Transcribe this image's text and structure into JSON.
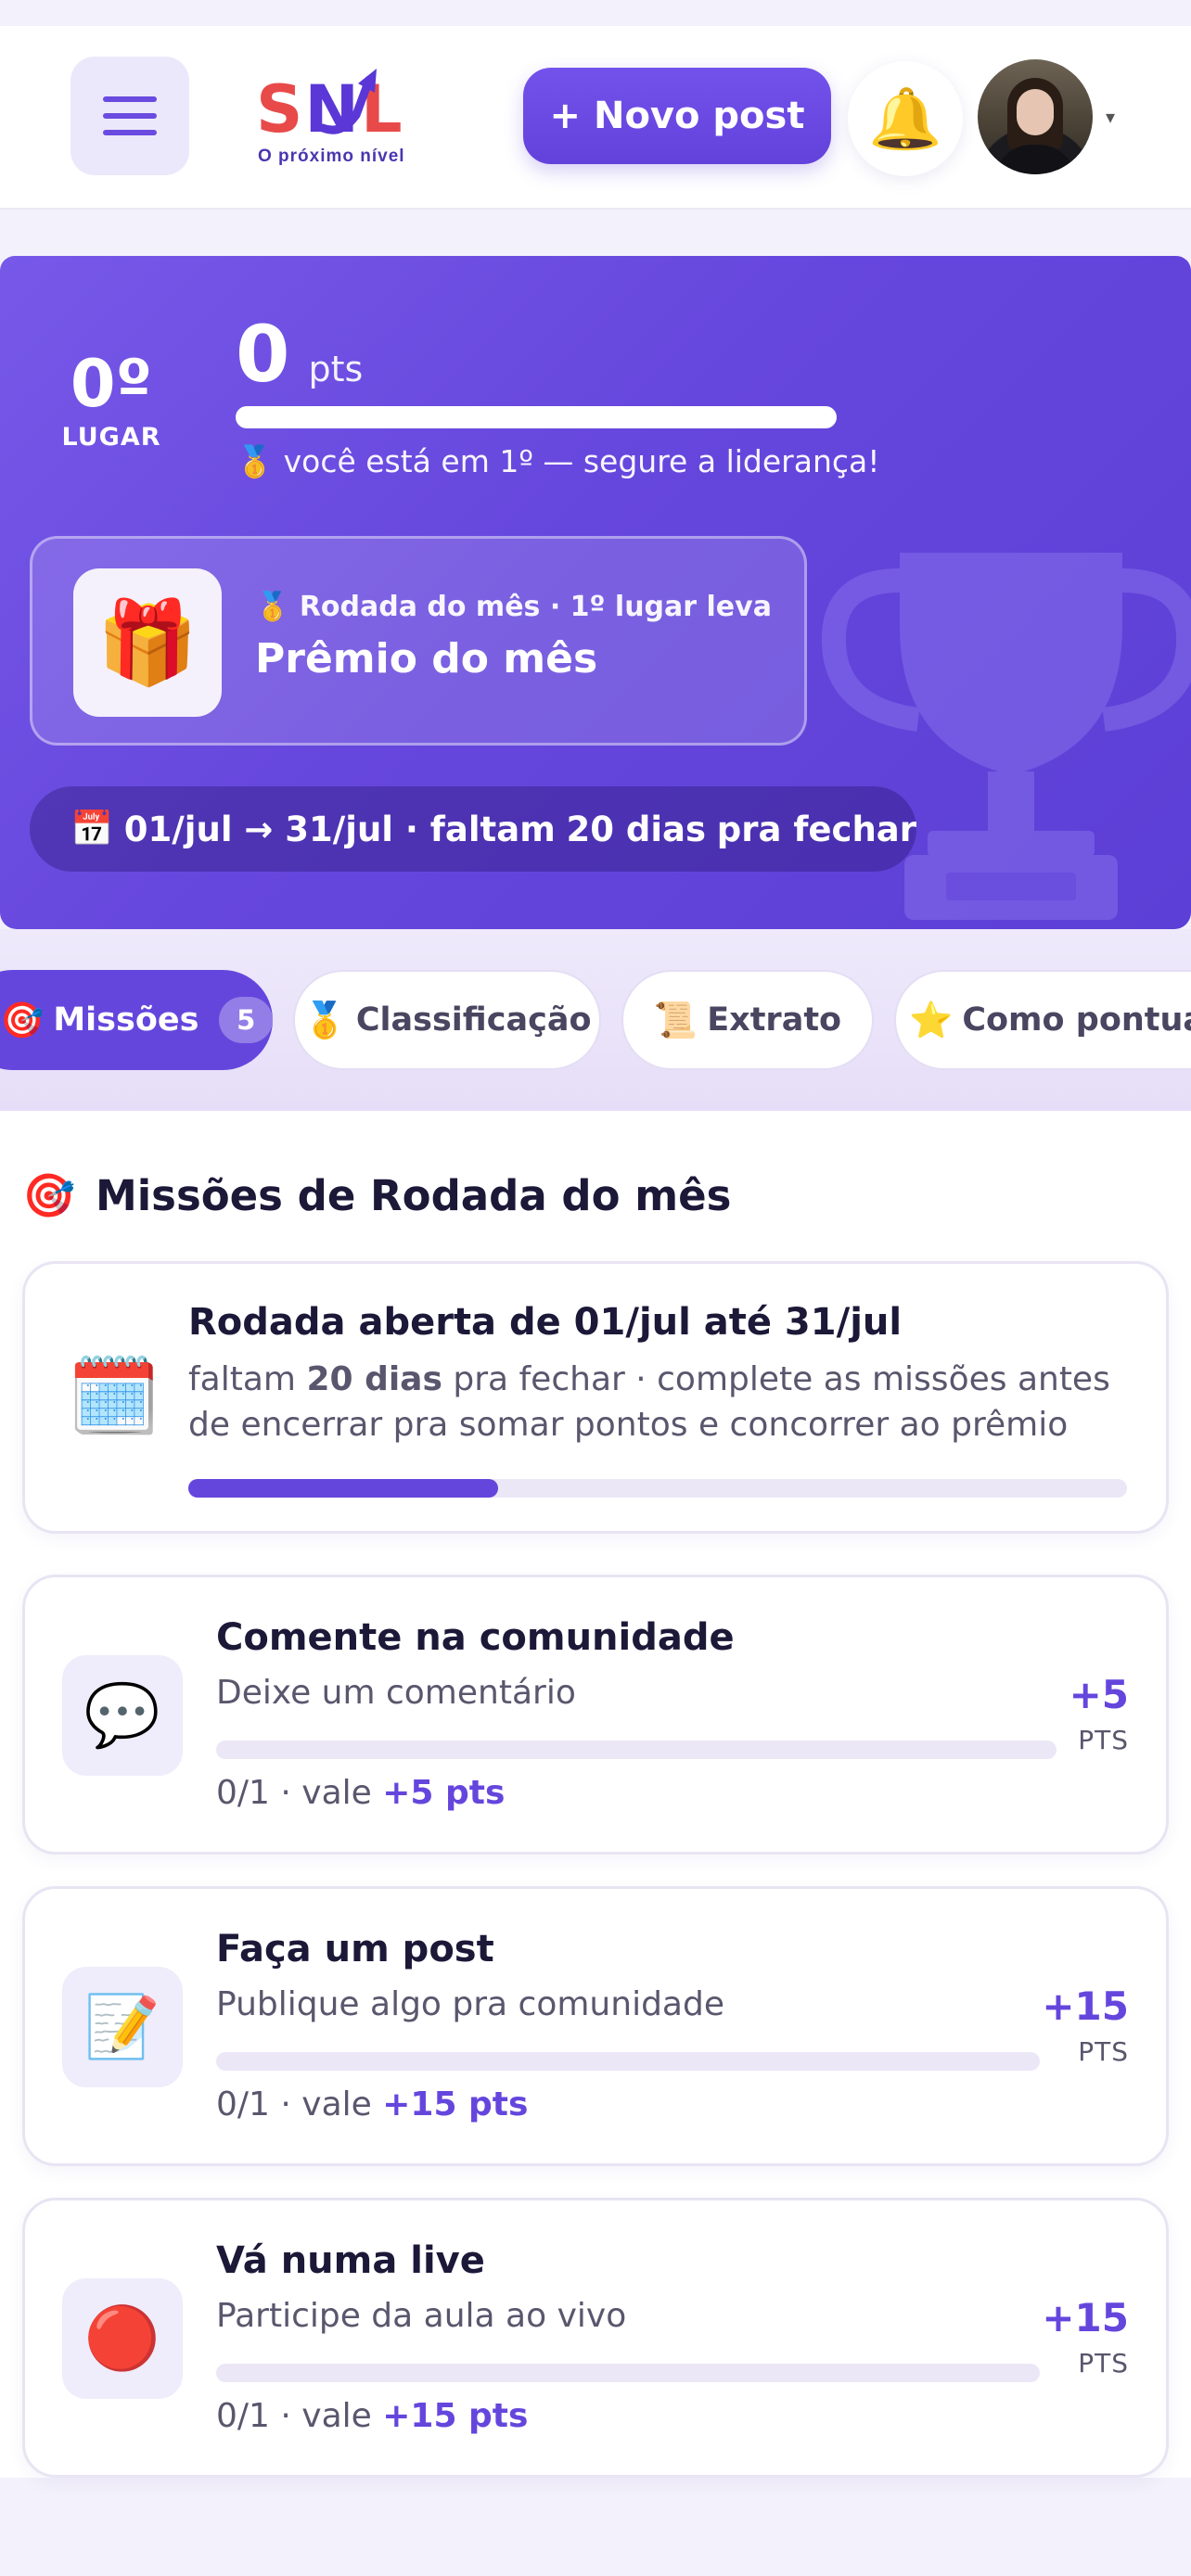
{
  "header": {
    "logo_text": "SNL",
    "logo_tagline": "O próximo nível",
    "new_post_label": "+ Novo post",
    "avatar_caret": "▾"
  },
  "hero": {
    "rank": "0º",
    "rank_label": "LUGAR",
    "points": "0",
    "points_unit": "pts",
    "points_progress": 1.0,
    "rank_message_icon": "🥇",
    "rank_message": "você está em 1º — segure a liderança!",
    "prize": {
      "icon": "🎁",
      "subtitle_icon": "🥇",
      "subtitle": "Rodada do mês · 1º lugar leva",
      "title": "Prêmio do mês"
    },
    "date_pill": {
      "icon": "📅",
      "range": "01/jul → 31/jul · faltam",
      "days": "20 dias",
      "suffix": "pra fechar"
    }
  },
  "tabs": [
    {
      "icon": "🎯",
      "label": "Missões",
      "badge": "5",
      "active": true
    },
    {
      "icon": "🥇",
      "label": "Classificação",
      "active": false
    },
    {
      "icon": "📜",
      "label": "Extrato",
      "active": false
    },
    {
      "icon": "⭐",
      "label": "Como pontua",
      "active": false
    }
  ],
  "section": {
    "icon": "🎯",
    "title": "Missões de Rodada do mês"
  },
  "round": {
    "icon": "🗓️",
    "title": "Rodada aberta de 01/jul até 31/jul",
    "text_prefix": "faltam ",
    "text_days": "20 dias",
    "text_suffix": " pra fechar · complete as missões antes de encerrar pra somar pontos e concorrer ao prêmio",
    "progress": 0.33
  },
  "missions": [
    {
      "icon": "💬",
      "title": "Comente na comunidade",
      "description": "Deixe um comentário",
      "progress": 0,
      "progress_text": "0/1 · vale ",
      "value_text": "+5 pts",
      "points": "+5",
      "points_unit": "PTS"
    },
    {
      "icon": "📝",
      "title": "Faça um post",
      "description": "Publique algo pra comunidade",
      "progress": 0,
      "progress_text": "0/1 · vale ",
      "value_text": "+15 pts",
      "points": "+15",
      "points_unit": "PTS"
    },
    {
      "icon": "🔴",
      "title": "Vá numa live",
      "description": "Participe da aula ao vivo",
      "progress": 0,
      "progress_text": "0/1 · vale ",
      "value_text": "+15 pts",
      "points": "+15",
      "points_unit": "PTS"
    }
  ],
  "colors": {
    "accent": "#6546dd",
    "hero_bg": "#6a4be0",
    "logo_red": "#e84a4a"
  },
  "icons": {
    "menu": "menu-icon",
    "bell": "bell-icon"
  }
}
